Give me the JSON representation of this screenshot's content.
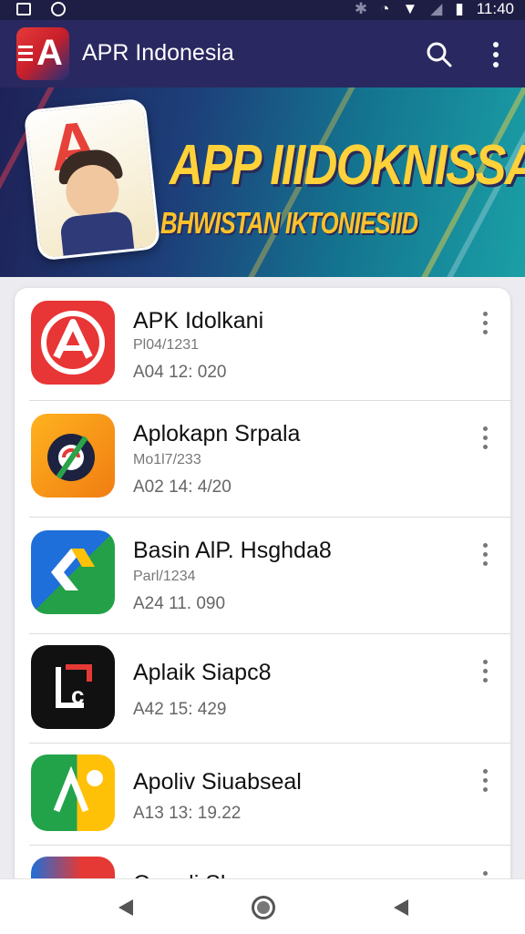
{
  "status_bar": {
    "time": "11:40"
  },
  "app_bar": {
    "title": "APR Indonesia"
  },
  "banner": {
    "title": "APP IIIDOKNISSA",
    "subtitle": "BHWISTAN IKTONIESIID"
  },
  "apps": [
    {
      "name": "APK Idolkani",
      "sub": "Pl04/1231",
      "date": "A04 12: 020"
    },
    {
      "name": "Aplokapn Srpala",
      "sub": "Mo1l7/233",
      "date": "A02 14: 4/20"
    },
    {
      "name": "Basin AlP. Hsghda8",
      "sub": "Parl/1234",
      "date": "A24 11. 090"
    },
    {
      "name": "Aplaik Siapc8",
      "sub": "",
      "date": "A42 15: 429"
    },
    {
      "name": "Apoliv Siuabseal",
      "sub": "",
      "date": "A13 13: 19.22"
    },
    {
      "name": "Qaaali Sluaaaaa",
      "sub": "",
      "date": ""
    }
  ],
  "colors": {
    "status_bar": "#1e1d44",
    "app_bar": "#2a2860",
    "banner_text": "#ffd23a"
  }
}
